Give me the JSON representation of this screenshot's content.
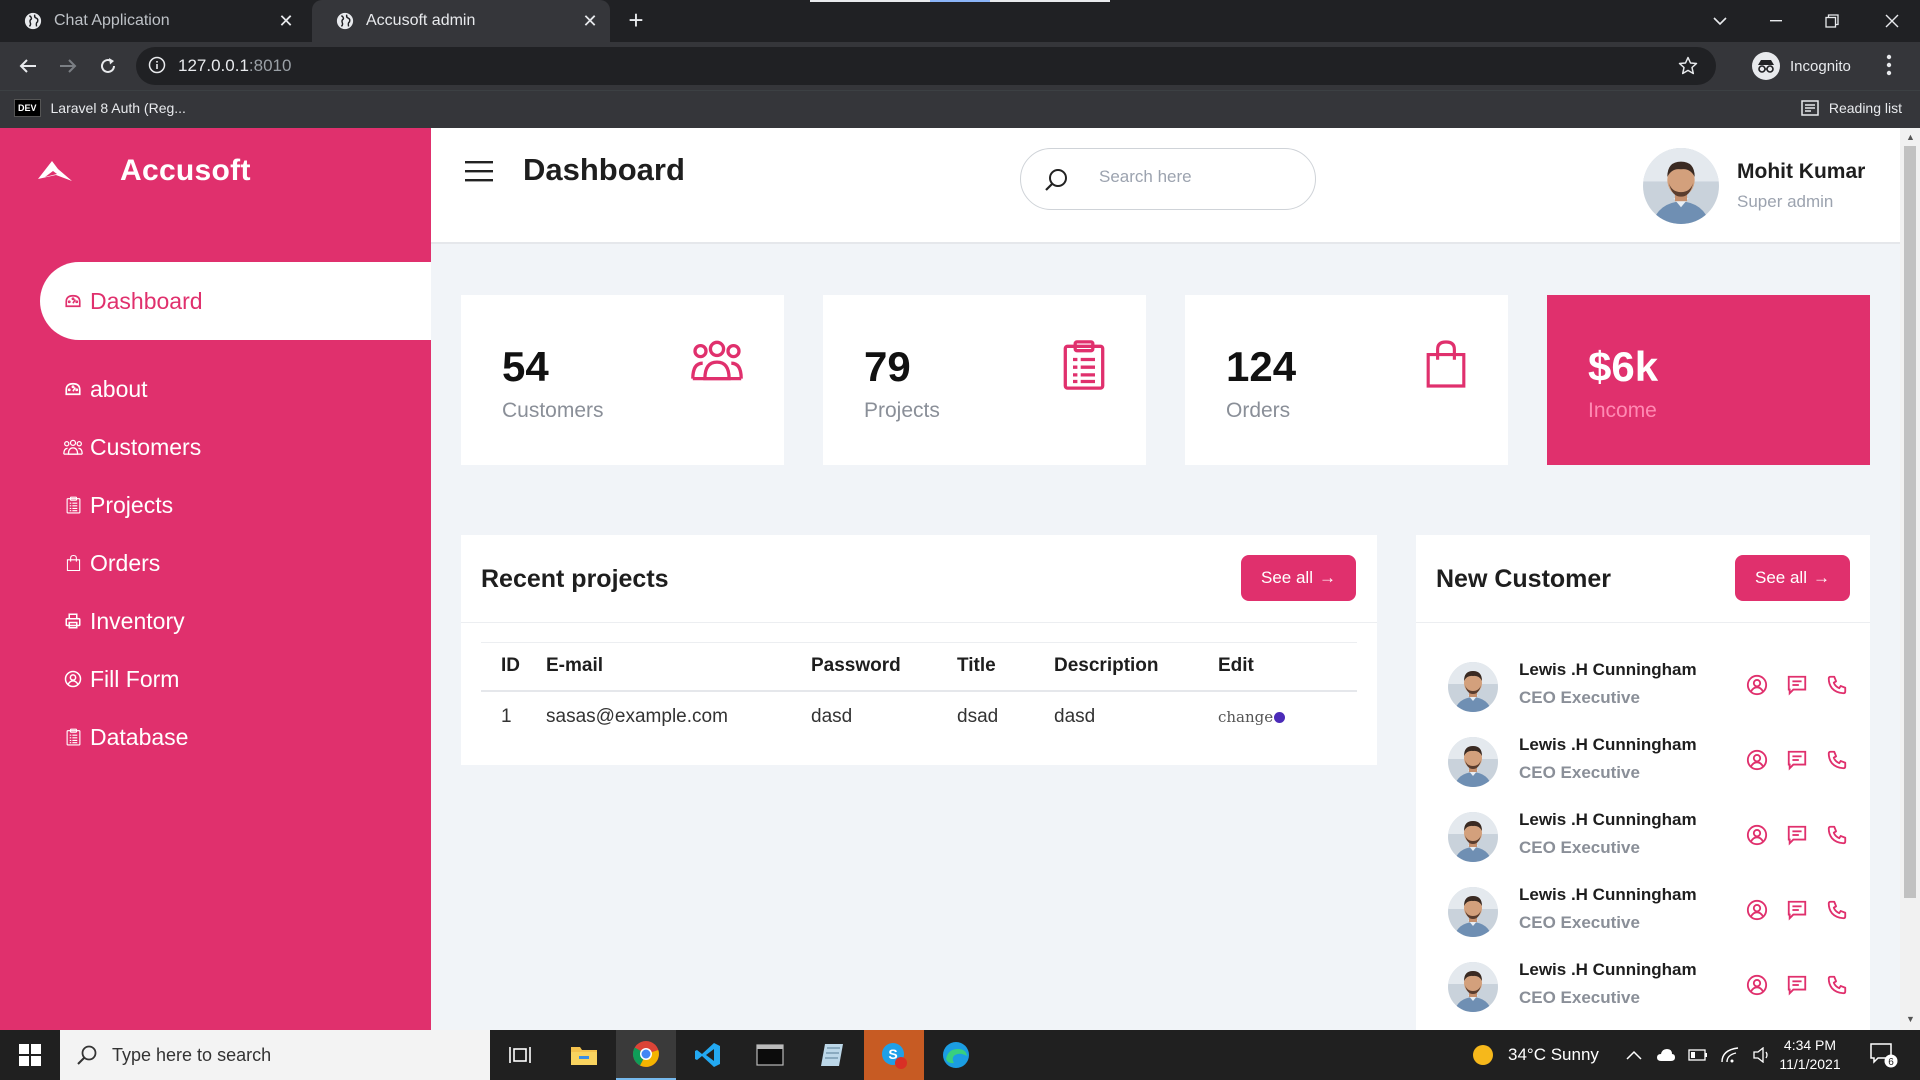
{
  "browser": {
    "tabs": [
      {
        "title": "Chat Application"
      },
      {
        "title": "Accusoft admin"
      }
    ],
    "url_host": "127.0.0.1",
    "url_port": ":8010",
    "profile_label": "Incognito",
    "bookmark_badge": "DEV",
    "bookmark": "Laravel 8 Auth (Reg...",
    "reading_list": "Reading list"
  },
  "sidebar": {
    "brand": "Accusoft",
    "items": [
      {
        "label": "Dashboard",
        "icon": "gauge-icon"
      },
      {
        "label": "about",
        "icon": "gauge-icon"
      },
      {
        "label": "Customers",
        "icon": "users-icon"
      },
      {
        "label": "Projects",
        "icon": "clipboard-icon"
      },
      {
        "label": "Orders",
        "icon": "bag-icon"
      },
      {
        "label": "Inventory",
        "icon": "printer-icon"
      },
      {
        "label": "Fill Form",
        "icon": "user-circle-icon"
      },
      {
        "label": "Database",
        "icon": "clipboard-icon"
      }
    ],
    "active_index": 0
  },
  "header": {
    "title": "Dashboard",
    "search_placeholder": "Search here",
    "user_name": "Mohit Kumar",
    "user_role": "Super admin"
  },
  "cards": [
    {
      "value": "54",
      "label": "Customers",
      "icon": "users-icon"
    },
    {
      "value": "79",
      "label": "Projects",
      "icon": "clipboard-icon"
    },
    {
      "value": "124",
      "label": "Orders",
      "icon": "bag-icon"
    },
    {
      "value": "$6k",
      "label": "Income",
      "icon": ""
    }
  ],
  "recent_projects": {
    "title": "Recent projects",
    "see_all": "See all",
    "columns": [
      "ID",
      "E-mail",
      "Password",
      "Title",
      "Description",
      "Edit"
    ],
    "rows": [
      {
        "id": "1",
        "email": "sasas@example.com",
        "password": "dasd",
        "title": "dsad",
        "description": "dasd",
        "edit": "change"
      }
    ]
  },
  "new_customer": {
    "title": "New Customer",
    "see_all": "See all",
    "items": [
      {
        "name": "Lewis .H Cunningham",
        "role": "CEO Executive"
      },
      {
        "name": "Lewis .H Cunningham",
        "role": "CEO Executive"
      },
      {
        "name": "Lewis .H Cunningham",
        "role": "CEO Executive"
      },
      {
        "name": "Lewis .H Cunningham",
        "role": "CEO Executive"
      },
      {
        "name": "Lewis .H Cunningham",
        "role": "CEO Executive"
      }
    ]
  },
  "taskbar": {
    "search_placeholder": "Type here to search",
    "weather": "34°C  Sunny",
    "time": "4:34 PM",
    "date": "11/1/2021",
    "notification_count": "6",
    "skype_badge": "1"
  },
  "colors": {
    "accent": "#e0306d",
    "background": "#f1f4f8",
    "chrome_dark": "#202124",
    "chrome_toolbar": "#35363a"
  }
}
